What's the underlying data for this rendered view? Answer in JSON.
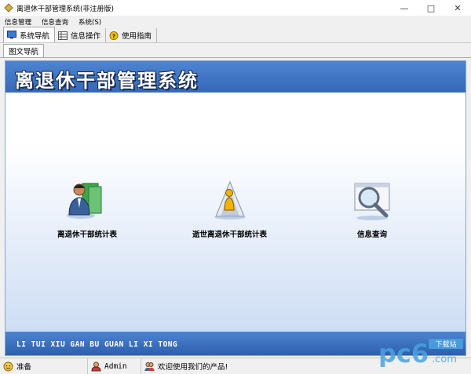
{
  "window": {
    "title": "离退休干部管理系统(非注册版)",
    "min_icon": "minimize-icon",
    "max_icon": "maximize-icon",
    "close_icon": "close-icon"
  },
  "menu": [
    "信息管理",
    "信息查询",
    "系统(S)"
  ],
  "toolbar": [
    {
      "label": "系统导航",
      "icon": "monitor-icon",
      "active": true
    },
    {
      "label": "信息操作",
      "icon": "grid-icon",
      "active": false
    },
    {
      "label": "使用指南",
      "icon": "help-icon",
      "active": false
    }
  ],
  "page_tab": "图文导航",
  "banner_title": "离退休干部管理系统",
  "nav": [
    {
      "label": "离退休干部统计表",
      "icon": "person-book-icon"
    },
    {
      "label": "逝世离退休干部统计表",
      "icon": "person-silhouette-icon"
    },
    {
      "label": "信息查询",
      "icon": "magnifier-icon"
    }
  ],
  "footer_text": "LI TUI XIU GAN BU GUAN LI XI TONG",
  "status": {
    "ready": "准备",
    "user": "Admin",
    "welcome": "欢迎使用我们的产品!"
  },
  "watermark": {
    "brand": "pc6",
    "sub": "下载站",
    "domain": ".com"
  },
  "colors": {
    "banner": "#3d74c4",
    "accent_blue": "#4d84d0",
    "watermark": "#4aa3e0"
  }
}
